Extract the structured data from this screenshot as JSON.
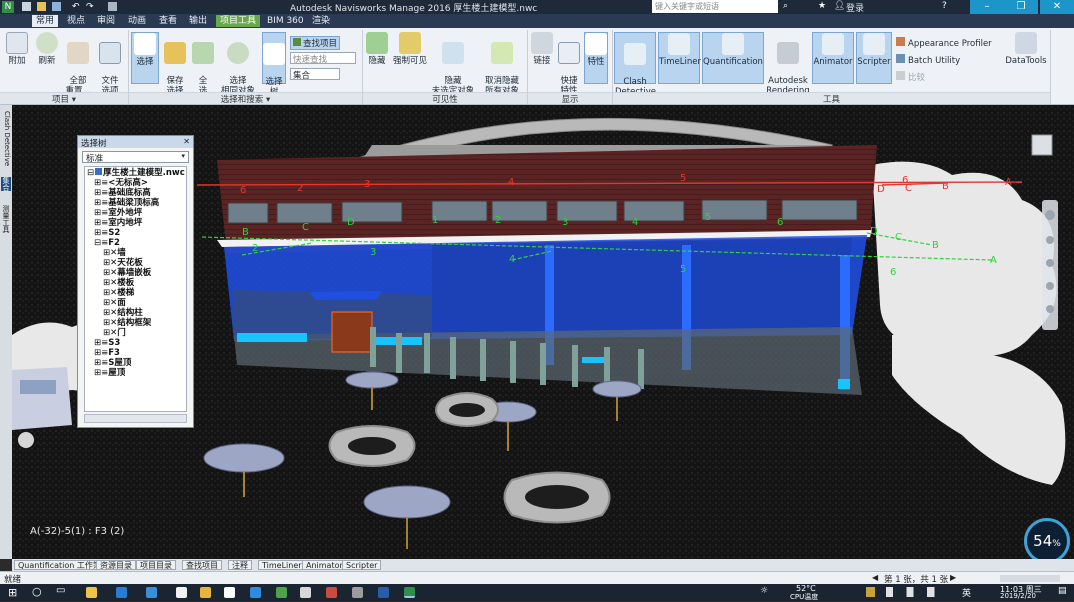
{
  "titlebar": {
    "title": "Autodesk Navisworks Manage 2016    厚生楼土建模型.nwc",
    "search_placeholder": "键入关键字或短语",
    "login": "登录"
  },
  "tabs": [
    "常用",
    "视点",
    "审阅",
    "动画",
    "查看",
    "输出",
    "项目工具",
    "BIM 360",
    "渲染"
  ],
  "ribbon": {
    "project": {
      "attach": "附加",
      "refresh": "刷新",
      "reset_all": "全部\n重置...",
      "file_options": "文件\n选项",
      "label": "项目 ▾"
    },
    "select_search": {
      "select": "选择",
      "save_selection": "保存\n选择",
      "select_all": "全\n选",
      "select_same": "选择\n相同对象",
      "selection_tree": "选择\n树",
      "find_items": "查找项目",
      "quick_find_placeholder": "快速查找",
      "sets": "集合",
      "label": "选择和搜索 ▾"
    },
    "visibility": {
      "hide": "隐藏",
      "require": "强制可见",
      "hide_unselected": "隐藏\n未选定对象",
      "unhide_all": "取消隐藏\n所有对象",
      "label": "可见性"
    },
    "display": {
      "links": "链接",
      "quick_props": "快捷\n特性",
      "properties": "特性",
      "label": "显示"
    },
    "tools": {
      "clash": "Clash\nDetective",
      "timeliner": "TimeLiner",
      "quantification": "Quantification",
      "rendering": "Autodesk\nRendering",
      "animator": "Animator",
      "scripter": "Scripter",
      "appearance": "Appearance Profiler",
      "batch": "Batch Utility",
      "compare": "比较",
      "datatools": "DataTools",
      "label": "工具"
    }
  },
  "tree": {
    "header": "选择树",
    "filter": "标准",
    "nodes": [
      "厚生楼土建模型.nwc",
      "<无标高>",
      "基础底标高",
      "基础梁顶标高",
      "室外地坪",
      "室内地坪",
      "S2",
      "F2",
      "墙",
      "天花板",
      "幕墙嵌板",
      "楼板",
      "楼梯",
      "面",
      "结构柱",
      "结构框架",
      "门",
      "S3",
      "F3",
      "S屋顶",
      "屋顶"
    ]
  },
  "left_strip": {
    "clash": "Clash Detective",
    "sets": "集合",
    "props": "测量工具"
  },
  "viewport": {
    "coord_readout": "A(-32)-5(1) : F3 (2)",
    "grid_letters": [
      "A",
      "B",
      "C",
      "D"
    ],
    "grid_numbers": [
      "1",
      "2",
      "3",
      "4",
      "5",
      "6"
    ],
    "cpu": "54",
    "cpu_unit": "%"
  },
  "pane_tabs": [
    "Quantification 工作簿",
    "资源目录",
    "项目目录",
    "查找项目",
    "注释",
    "TimeLiner",
    "Animator",
    "Scripter"
  ],
  "status": {
    "left": "就绪",
    "page": "第 1 张，共 1 张"
  },
  "taskbar": {
    "weather": "52°C",
    "weather_sub": "CPU温度",
    "lang": "英",
    "time": "11:03 周三",
    "date": "2019/2/20"
  },
  "colors": {
    "accent": "#2b63c6",
    "highlight_blue": "#1f4fe0",
    "grid_red": "#e0382e",
    "grid_green": "#2fd33c"
  }
}
